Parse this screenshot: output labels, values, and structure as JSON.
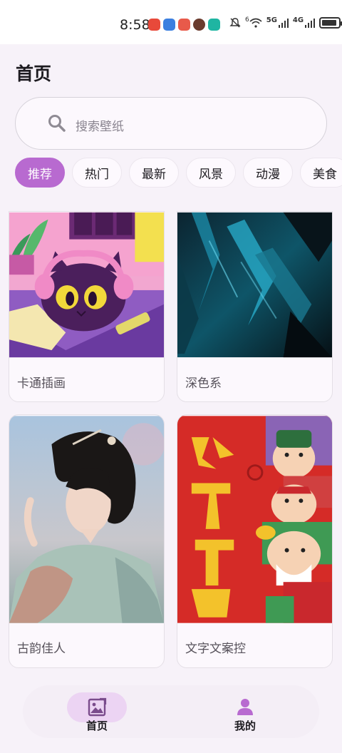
{
  "status_bar": {
    "time": "8:58",
    "network_5g": "5G",
    "network_4g": "4G",
    "network_6": "6"
  },
  "header": {
    "title": "首页"
  },
  "search": {
    "placeholder": "搜索壁纸",
    "icon": "search-icon"
  },
  "categories": [
    {
      "label": "推荐",
      "active": true
    },
    {
      "label": "热门",
      "active": false
    },
    {
      "label": "最新",
      "active": false
    },
    {
      "label": "风景",
      "active": false
    },
    {
      "label": "动漫",
      "active": false
    },
    {
      "label": "美食",
      "active": false
    }
  ],
  "wallpapers": [
    {
      "title": "卡通插画"
    },
    {
      "title": "深色系"
    },
    {
      "title": "古韵佳人"
    },
    {
      "title": "文字文案控"
    }
  ],
  "nav": {
    "home_label": "首页",
    "profile_label": "我的"
  },
  "colors": {
    "accent": "#b86ad0",
    "nav_active_bg": "#ecd4f3",
    "background": "#f7f2f9"
  }
}
